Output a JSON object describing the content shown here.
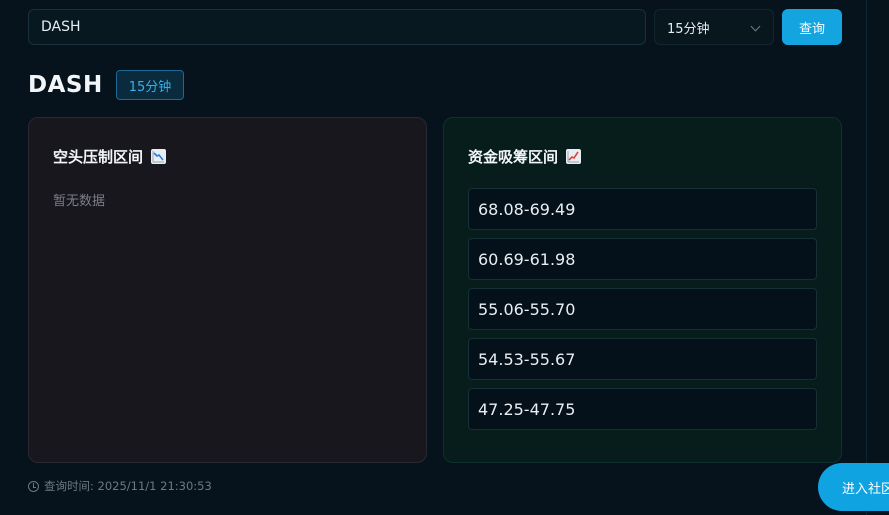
{
  "search": {
    "value": "DASH"
  },
  "interval_select": {
    "selected": "15分钟"
  },
  "query_button": {
    "label": "查询"
  },
  "header": {
    "symbol": "DASH",
    "interval_badge": "15分钟"
  },
  "short_pressure": {
    "title": "空头压制区间",
    "icon": "chart-decreasing-icon",
    "empty_text": "暂无数据"
  },
  "accumulation": {
    "title": "资金吸筹区间",
    "icon": "chart-increasing-icon",
    "ranges": [
      "68.08-69.49",
      "60.69-61.98",
      "55.06-55.70",
      "54.53-55.67",
      "47.25-47.75"
    ]
  },
  "footer": {
    "query_time": "查询时间: 2025/11/1 21:30:53"
  },
  "community_button": {
    "label": "进入社区"
  },
  "colors": {
    "accent": "#14a4e0",
    "short_card_bg": "#17171d",
    "accum_card_bg": "#061d1b"
  }
}
